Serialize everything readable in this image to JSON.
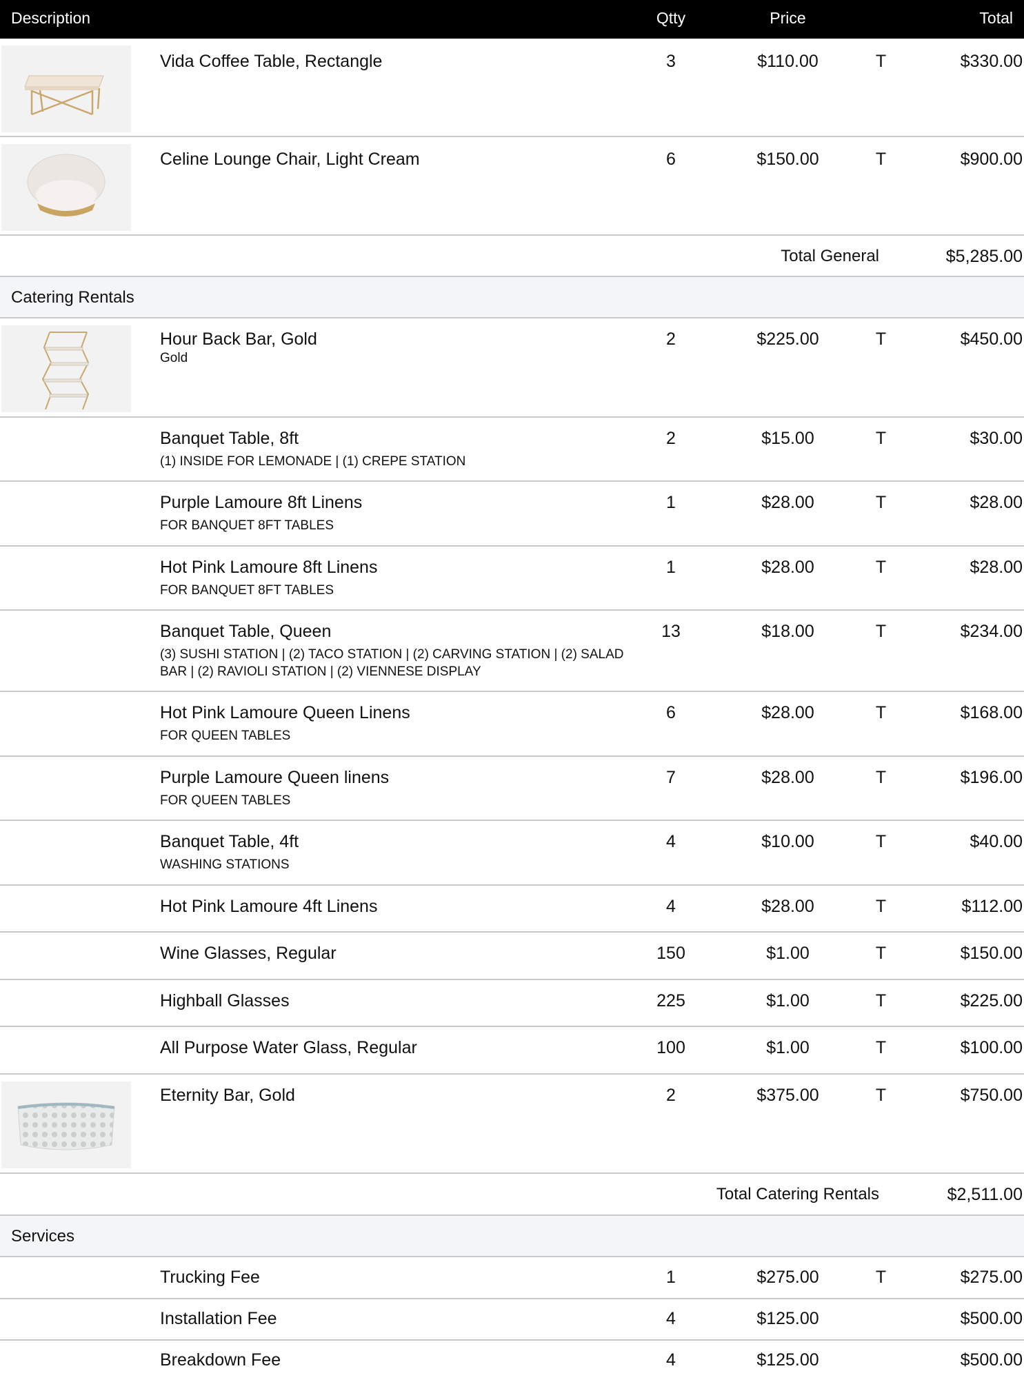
{
  "columns": {
    "description": "Description",
    "qty": "Qtty",
    "price": "Price",
    "total": "Total"
  },
  "general_tail": [
    {
      "name": "Vida Coffee Table, Rectangle",
      "qty": "3",
      "price": "$110.00",
      "tax": "T",
      "total": "$330.00",
      "thumb": "coffee-table"
    },
    {
      "name": "Celine Lounge Chair, Light Cream",
      "qty": "6",
      "price": "$150.00",
      "tax": "T",
      "total": "$900.00",
      "thumb": "lounge-chair"
    }
  ],
  "total_general": {
    "label": "Total General",
    "amount": "$5,285.00"
  },
  "catering": {
    "title": "Catering Rentals",
    "items": [
      {
        "name": "Hour Back Bar, Gold",
        "note": "Gold",
        "qty": "2",
        "price": "$225.00",
        "tax": "T",
        "total": "$450.00",
        "thumb": "back-bar"
      },
      {
        "name": "Banquet Table, 8ft",
        "note": "(1) INSIDE FOR LEMONADE | (1) CREPE STATION",
        "qty": "2",
        "price": "$15.00",
        "tax": "T",
        "total": "$30.00"
      },
      {
        "name": "Purple Lamoure 8ft Linens",
        "note": "FOR BANQUET 8FT TABLES",
        "qty": "1",
        "price": "$28.00",
        "tax": "T",
        "total": "$28.00"
      },
      {
        "name": "Hot Pink Lamoure 8ft Linens",
        "note": "FOR BANQUET 8FT TABLES",
        "qty": "1",
        "price": "$28.00",
        "tax": "T",
        "total": "$28.00"
      },
      {
        "name": "Banquet Table, Queen",
        "note": "(3) SUSHI STATION | (2) TACO STATION | (2) CARVING STATION | (2) SALAD BAR | (2) RAVIOLI STATION | (2) VIENNESE DISPLAY",
        "qty": "13",
        "price": "$18.00",
        "tax": "T",
        "total": "$234.00"
      },
      {
        "name": "Hot Pink Lamoure Queen Linens",
        "note": "FOR QUEEN TABLES",
        "qty": "6",
        "price": "$28.00",
        "tax": "T",
        "total": "$168.00"
      },
      {
        "name": "Purple Lamoure Queen linens",
        "note": "FOR QUEEN TABLES",
        "qty": "7",
        "price": "$28.00",
        "tax": "T",
        "total": "$196.00"
      },
      {
        "name": "Banquet Table, 4ft",
        "note": "WASHING STATIONS",
        "qty": "4",
        "price": "$10.00",
        "tax": "T",
        "total": "$40.00"
      },
      {
        "name": "Hot Pink Lamoure 4ft Linens",
        "qty": "4",
        "price": "$28.00",
        "tax": "T",
        "total": "$112.00"
      },
      {
        "name": "Wine Glasses, Regular",
        "qty": "150",
        "price": "$1.00",
        "tax": "T",
        "total": "$150.00"
      },
      {
        "name": "Highball Glasses",
        "qty": "225",
        "price": "$1.00",
        "tax": "T",
        "total": "$225.00"
      },
      {
        "name": "All Purpose Water Glass, Regular",
        "qty": "100",
        "price": "$1.00",
        "tax": "T",
        "total": "$100.00"
      },
      {
        "name": "Eternity Bar, Gold",
        "qty": "2",
        "price": "$375.00",
        "tax": "T",
        "total": "$750.00",
        "thumb": "eternity-bar"
      }
    ],
    "total": {
      "label": "Total Catering Rentals",
      "amount": "$2,511.00"
    }
  },
  "services": {
    "title": "Services",
    "items": [
      {
        "name": "Trucking Fee",
        "qty": "1",
        "price": "$275.00",
        "tax": "T",
        "total": "$275.00"
      },
      {
        "name": "Installation Fee",
        "qty": "4",
        "price": "$125.00",
        "tax": "",
        "total": "$500.00"
      },
      {
        "name": "Breakdown Fee",
        "qty": "4",
        "price": "$125.00",
        "tax": "",
        "total": "$500.00"
      }
    ]
  }
}
